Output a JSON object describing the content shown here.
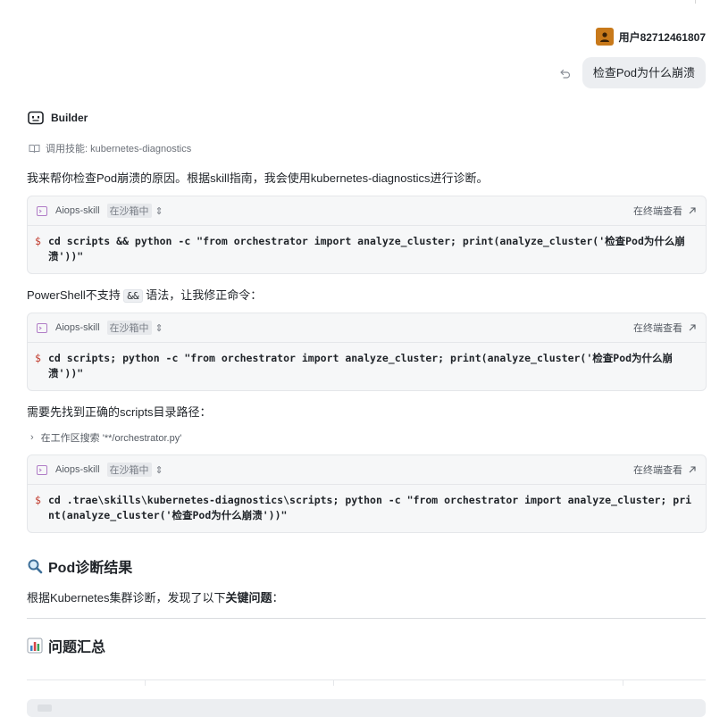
{
  "user": {
    "name": "用户82712461807",
    "message": "检查Pod为什么崩溃"
  },
  "assistant": {
    "name": "Builder",
    "skill_invocation": "调用技能: kubernetes-diagnostics",
    "intro": "我来帮你检查Pod崩溃的原因。根据skill指南，我会使用kubernetes-diagnostics进行诊断。",
    "powershell_note_before": "PowerShell不支持",
    "powershell_note_code": "&&",
    "powershell_note_after": "语法，让我修正命令：",
    "path_note": "需要先找到正确的scripts目录路径：",
    "workspace_search": "在工作区搜索 '**/orchestrator.py'",
    "result_heading": "Pod诊断结果",
    "result_intro_before": "根据Kubernetes集群诊断，发现了以下",
    "result_intro_bold": "关键问题",
    "result_intro_after": "：",
    "summary_heading": "问题汇总"
  },
  "terminals": [
    {
      "title": "Aiops-skill",
      "badge": "在沙箱中",
      "open_label": "在终端查看",
      "prompt": "$",
      "command": "cd scripts && python -c \"from orchestrator import analyze_cluster; print(analyze_cluster('检查Pod为什么崩溃'))\""
    },
    {
      "title": "Aiops-skill",
      "badge": "在沙箱中",
      "open_label": "在终端查看",
      "prompt": "$",
      "command": "cd scripts; python -c \"from orchestrator import analyze_cluster; print(analyze_cluster('检查Pod为什么崩溃'))\""
    },
    {
      "title": "Aiops-skill",
      "badge": "在沙箱中",
      "open_label": "在终端查看",
      "prompt": "$",
      "command": "cd .trae\\skills\\kubernetes-diagnostics\\scripts; python -c \"from orchestrator import analyze_cluster; print(analyze_cluster('检查Pod为什么崩溃'))\""
    }
  ],
  "icons": {
    "undo": "undo-icon",
    "bot": "bot-icon",
    "book": "book-icon",
    "terminal": "terminal-icon",
    "updown": "chevron-updown-icon",
    "external": "arrow-up-right-icon",
    "chevron": "chevron-right-icon",
    "search": "magnifier-icon",
    "chart": "bar-chart-icon"
  },
  "colors": {
    "avatar": "#c8791a",
    "terminal_icon": "#b07cc6",
    "prompt": "#c0392b",
    "bubble": "#eceef1"
  }
}
